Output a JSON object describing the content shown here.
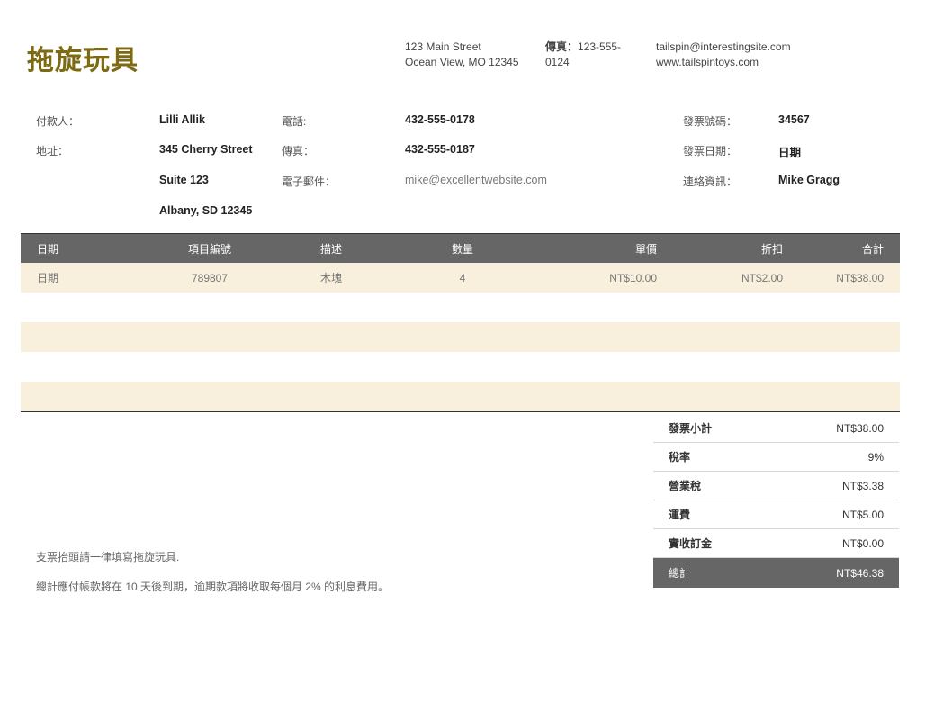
{
  "company": {
    "name": "拖旋玩具",
    "address_line1": "123 Main Street",
    "address_line2": "Ocean View, MO 12345",
    "fax_label": "傳真：",
    "fax_value_line1": "123-555-",
    "fax_value_line2": "0124",
    "email": "tailspin@interestingsite.com",
    "website": "www.tailspintoys.com"
  },
  "billing": {
    "payer_label": "付款人：",
    "payer_name": "Lilli Allik",
    "address_label": "地址：",
    "address_line1": "345 Cherry Street",
    "address_line2": "Suite 123",
    "address_line3": "Albany, SD 12345",
    "phone_label": "電話:",
    "phone_value": "432-555-0178",
    "fax_label": "傳真：",
    "fax_value": "432-555-0187",
    "email_label": "電子郵件：",
    "email_value": "mike@excellentwebsite.com",
    "invoice_no_label": "發票號碼：",
    "invoice_no_value": "34567",
    "invoice_date_label": "發票日期：",
    "invoice_date_value": "日期",
    "contact_label": "連絡資訊：",
    "contact_value": "Mike Gragg"
  },
  "table": {
    "headers": [
      "日期",
      "項目編號",
      "描述",
      "數量",
      "單價",
      "折扣",
      "合計"
    ],
    "rows": [
      [
        "日期",
        "789807",
        "木塊",
        "4",
        "NT$10.00",
        "NT$2.00",
        "NT$38.00"
      ],
      [
        "",
        "",
        "",
        "",
        "",
        "",
        ""
      ],
      [
        "",
        "",
        "",
        "",
        "",
        "",
        ""
      ],
      [
        "",
        "",
        "",
        "",
        "",
        "",
        ""
      ],
      [
        "",
        "",
        "",
        "",
        "",
        "",
        ""
      ]
    ]
  },
  "totals": {
    "subtotal_label": "發票小計",
    "subtotal_value": "NT$38.00",
    "tax_rate_label": "稅率",
    "tax_rate_value": "9%",
    "sales_tax_label": "營業稅",
    "sales_tax_value": "NT$3.38",
    "shipping_label": "運費",
    "shipping_value": "NT$5.00",
    "deposit_label": "實收訂金",
    "deposit_value": "NT$0.00",
    "total_label": "總計",
    "total_value": "NT$46.38"
  },
  "footer": {
    "payable_note": "支票抬頭請一律填寫拖旋玩具.",
    "terms_note": "總計應付帳款將在 10 天後到期，逾期款項將收取每個月 2% 的利息費用。"
  },
  "colors": {
    "brand": "#7d6a12",
    "header_bg": "#666666",
    "row_alt": "#f8f0dc"
  }
}
